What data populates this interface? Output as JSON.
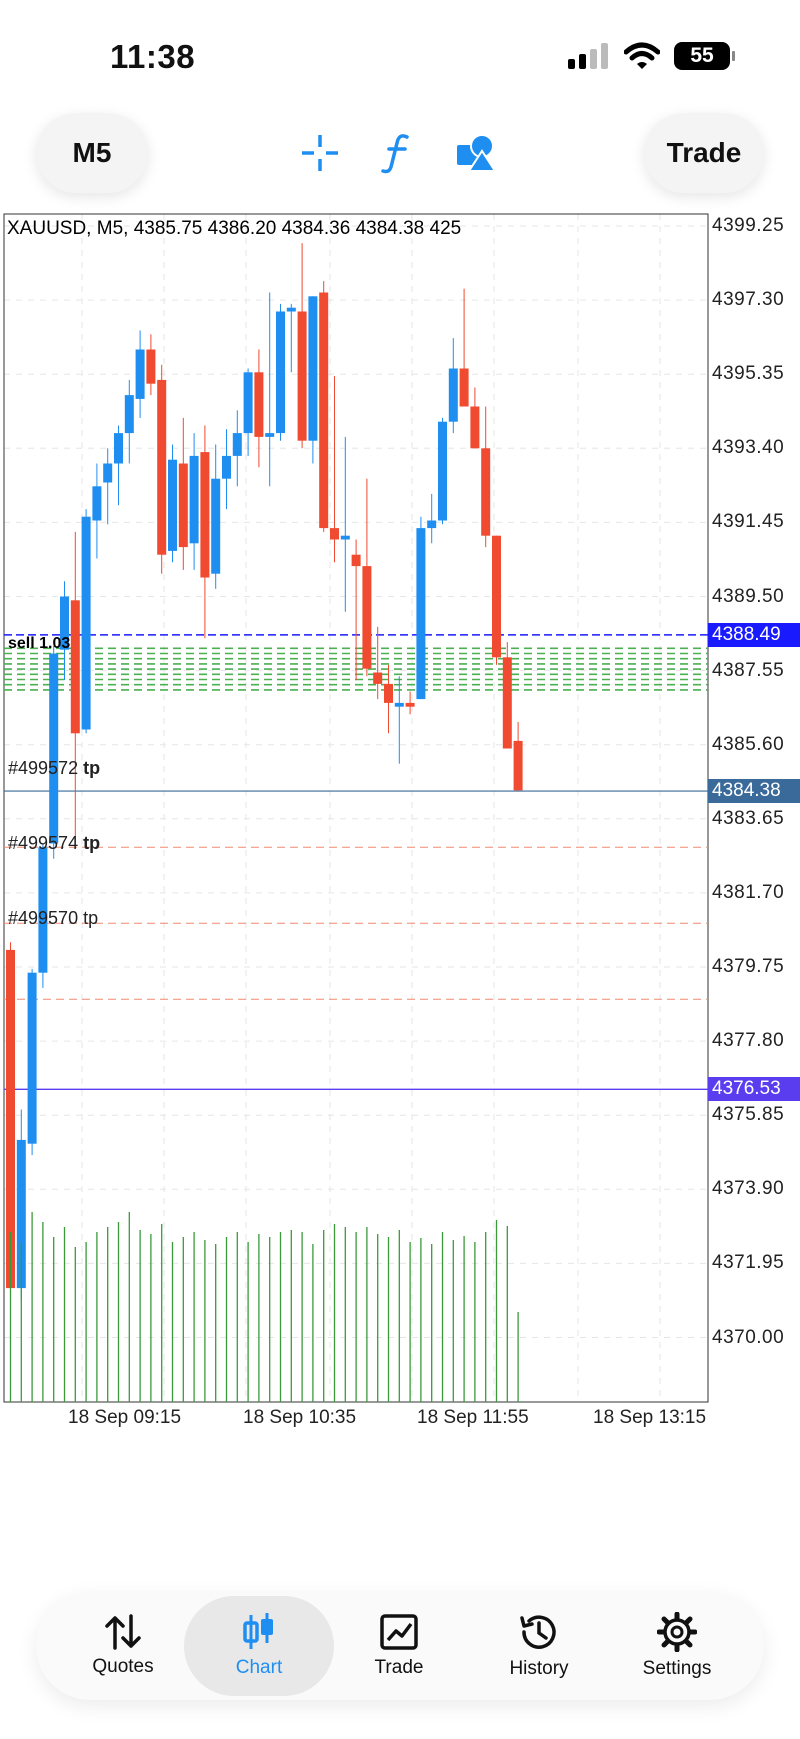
{
  "status": {
    "time": "11:38",
    "battery": "55"
  },
  "toolbar": {
    "timeframe": "M5",
    "trade": "Trade",
    "icons": [
      "crosshair-icon",
      "function-icon",
      "objects-icon"
    ]
  },
  "chart": {
    "header": "XAUUSD, M5, 4385.75 4386.20 4384.36 4384.38 425",
    "price_ticks": [
      "4399.25",
      "4397.30",
      "4395.35",
      "4393.40",
      "4391.45",
      "4389.50",
      "4387.55",
      "4385.60",
      "4383.65",
      "4381.70",
      "4379.75",
      "4377.80",
      "4375.85",
      "4373.90",
      "4371.95",
      "4370.00"
    ],
    "bid_tag": "4388.49",
    "last_tag": "4384.38",
    "line_tag": "4376.53",
    "time_labels": [
      "18 Sep 09:15",
      "18 Sep 10:35",
      "18 Sep 11:55",
      "18 Sep 13:15"
    ],
    "tp_lines": [
      {
        "id": "#499572",
        "suffix": "tp"
      },
      {
        "id": "#499574",
        "suffix": "tp"
      },
      {
        "id": "#499570",
        "suffix": "tp"
      }
    ],
    "order_stack": "sell 1.03",
    "colors": {
      "up": "#1f8ef1",
      "down": "#f04a30",
      "volume": "#3a9a3a",
      "bid": "#1a1aff",
      "last": "#3a6a9a",
      "line": "#5b3df0"
    }
  },
  "chart_data": {
    "type": "candlestick",
    "symbol": "XAUUSD",
    "timeframe": "M5",
    "ylim": [
      4370.0,
      4399.25
    ],
    "ohlc": [
      [
        4380.2,
        4380.4,
        4371.3,
        4371.3
      ],
      [
        4371.3,
        4376.0,
        4371.0,
        4375.2
      ],
      [
        4375.1,
        4379.7,
        4374.8,
        4379.6
      ],
      [
        4379.6,
        4383.0,
        4379.2,
        4382.9
      ],
      [
        4383.0,
        4388.2,
        4382.6,
        4388.0
      ],
      [
        4388.1,
        4389.9,
        4387.3,
        4389.5
      ],
      [
        4389.4,
        4391.2,
        4382.9,
        4385.9
      ],
      [
        4386.0,
        4391.8,
        4385.9,
        4391.6
      ],
      [
        4391.5,
        4393.0,
        4390.5,
        4392.4
      ],
      [
        4392.5,
        4393.4,
        4391.4,
        4393.0
      ],
      [
        4393.0,
        4394.0,
        4391.9,
        4393.8
      ],
      [
        4393.8,
        4395.2,
        4393.0,
        4394.8
      ],
      [
        4394.7,
        4396.5,
        4394.2,
        4396.0
      ],
      [
        4396.0,
        4396.4,
        4394.8,
        4395.1
      ],
      [
        4395.2,
        4395.6,
        4390.1,
        4390.6
      ],
      [
        4390.7,
        4393.5,
        4390.4,
        4393.1
      ],
      [
        4393.0,
        4394.2,
        4390.2,
        4390.8
      ],
      [
        4390.9,
        4393.8,
        4390.2,
        4393.2
      ],
      [
        4393.3,
        4394.0,
        4388.4,
        4390.0
      ],
      [
        4390.1,
        4393.5,
        4389.7,
        4392.6
      ],
      [
        4392.6,
        4393.9,
        4391.8,
        4393.2
      ],
      [
        4393.2,
        4394.4,
        4392.4,
        4393.8
      ],
      [
        4393.8,
        4395.5,
        4393.2,
        4395.4
      ],
      [
        4395.4,
        4396.0,
        4392.9,
        4393.7
      ],
      [
        4393.7,
        4397.5,
        4392.4,
        4393.8
      ],
      [
        4393.8,
        4397.2,
        4393.6,
        4397.0
      ],
      [
        4397.0,
        4397.2,
        4395.4,
        4397.1
      ],
      [
        4397.0,
        4398.8,
        4393.4,
        4393.6
      ],
      [
        4393.6,
        4397.4,
        4393.0,
        4397.4
      ],
      [
        4397.5,
        4397.8,
        4391.2,
        4391.3
      ],
      [
        4391.3,
        4395.3,
        4390.4,
        4391.0
      ],
      [
        4391.0,
        4393.7,
        4389.1,
        4391.1
      ],
      [
        4390.6,
        4391.0,
        4387.3,
        4390.3
      ],
      [
        4390.3,
        4392.6,
        4387.4,
        4387.6
      ],
      [
        4387.5,
        4388.7,
        4386.8,
        4387.2
      ],
      [
        4387.2,
        4387.7,
        4385.9,
        4386.7
      ],
      [
        4386.6,
        4387.4,
        4385.1,
        4386.7
      ],
      [
        4386.7,
        4387.0,
        4386.4,
        4386.6
      ],
      [
        4386.8,
        4391.6,
        4386.8,
        4391.3
      ],
      [
        4391.3,
        4392.2,
        4390.9,
        4391.5
      ],
      [
        4391.5,
        4394.2,
        4391.4,
        4394.1
      ],
      [
        4394.1,
        4396.3,
        4393.8,
        4395.5
      ],
      [
        4395.5,
        4397.6,
        4394.9,
        4394.5
      ],
      [
        4394.5,
        4395.0,
        4393.4,
        4393.4
      ],
      [
        4393.4,
        4394.5,
        4390.8,
        4391.1
      ],
      [
        4391.1,
        4391.1,
        4387.7,
        4387.9
      ],
      [
        4387.9,
        4388.3,
        4385.5,
        4385.5
      ],
      [
        4385.7,
        4386.2,
        4384.4,
        4384.4
      ]
    ],
    "volume_note": "volume histogram below price pane"
  },
  "nav": {
    "items": [
      {
        "label": "Quotes",
        "icon": "quotes-arrows-icon"
      },
      {
        "label": "Chart",
        "icon": "chart-candles-icon"
      },
      {
        "label": "Trade",
        "icon": "trade-chart-icon"
      },
      {
        "label": "History",
        "icon": "history-clock-icon"
      },
      {
        "label": "Settings",
        "icon": "settings-gear-icon"
      }
    ]
  }
}
